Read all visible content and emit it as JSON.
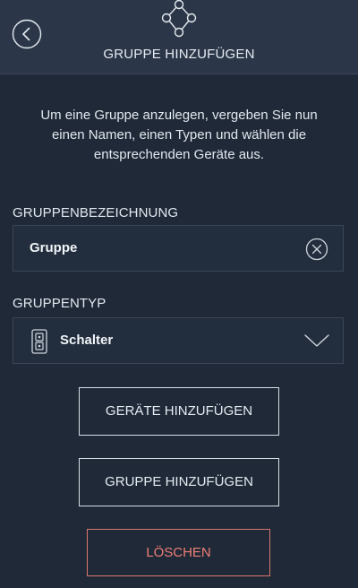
{
  "header": {
    "title": "GRUPPE HINZUFÜGEN",
    "back_icon": "back-arrow-circle-icon",
    "group_icon": "group-nodes-icon"
  },
  "intro": {
    "text": "Um eine Gruppe anzulegen, vergeben Sie nun einen Namen, einen Typen und wählen die entsprechenden Geräte aus."
  },
  "name_section": {
    "label": "GRUPPENBEZEICHNUNG",
    "value": "Gruppe",
    "clear_icon": "clear-circle-x-icon"
  },
  "type_section": {
    "label": "GRUPPENTYP",
    "selected": "Schalter",
    "type_icon": "switch-device-icon",
    "dropdown_icon": "chevron-down-icon"
  },
  "actions": {
    "add_devices": "GERÄTE HINZUFÜGEN",
    "add_group": "GRUPPE HINZUFÜGEN",
    "delete": "LÖSCHEN"
  },
  "colors": {
    "background": "#1f2938",
    "header": "#2b3748",
    "field_border": "#3a4658",
    "text": "#e6ebf1",
    "delete": "#ee7f76"
  }
}
